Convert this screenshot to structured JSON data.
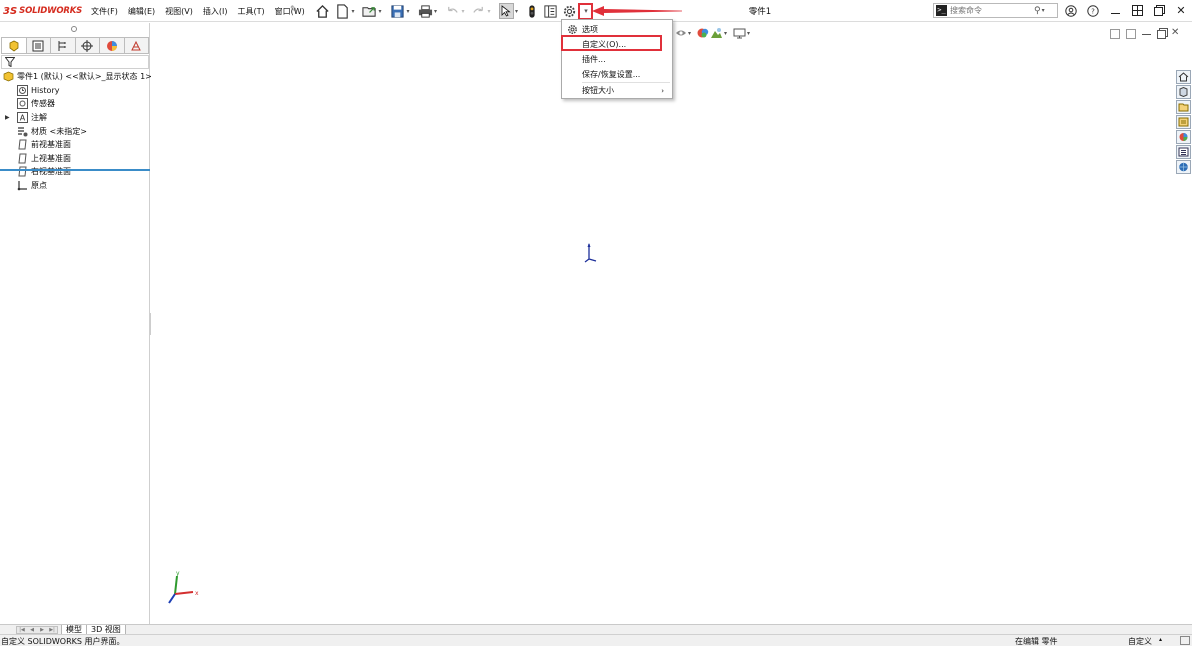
{
  "app": {
    "logo_mark": "3S",
    "logo_text": "SOLIDWORKS",
    "document_title": "零件1"
  },
  "menubar": {
    "items": [
      {
        "label": "文件(F)"
      },
      {
        "label": "编辑(E)"
      },
      {
        "label": "视图(V)"
      },
      {
        "label": "插入(I)"
      },
      {
        "label": "工具(T)"
      },
      {
        "label": "窗口(W)"
      }
    ]
  },
  "search": {
    "placeholder": "搜索命令"
  },
  "feature_tree": {
    "root": "零件1 (默认) <<默认>_显示状态 1>",
    "items": [
      {
        "label": "History",
        "icon": "history-icon"
      },
      {
        "label": "传感器",
        "icon": "sensor-icon"
      },
      {
        "label": "注解",
        "icon": "annotation-icon",
        "expandable": true
      },
      {
        "label": "材质 <未指定>",
        "icon": "material-icon"
      },
      {
        "label": "前视基准面",
        "icon": "plane-icon"
      },
      {
        "label": "上视基准面",
        "icon": "plane-icon"
      },
      {
        "label": "右视基准面",
        "icon": "plane-icon"
      },
      {
        "label": "原点",
        "icon": "origin-icon"
      }
    ]
  },
  "options_dropdown": {
    "items": [
      {
        "label": "选项",
        "icon": "gear-icon"
      },
      {
        "label": "自定义(O)...",
        "highlighted": true
      },
      {
        "label": "插件..."
      },
      {
        "label": "保存/恢复设置..."
      },
      {
        "label": "按钮大小",
        "submenu": true
      }
    ]
  },
  "triad": {
    "x_label": "x",
    "y_label": "y"
  },
  "bottom_tabs": {
    "model": "模型",
    "view3d": "3D 视图"
  },
  "status": {
    "message": "自定义 SOLIDWORKS 用户界面。",
    "edit_state": "在编辑 零件",
    "custom_label": "自定义"
  },
  "colors": {
    "brand": "#d52b1e",
    "highlight": "#e0303a",
    "tree_rule": "#3a8cc8"
  }
}
